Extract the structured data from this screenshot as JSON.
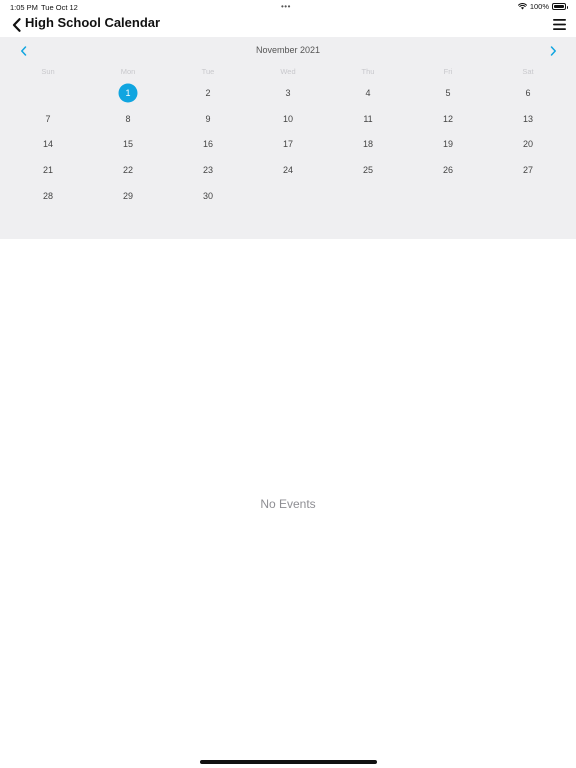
{
  "status_bar": {
    "time": "1:05 PM",
    "date": "Tue Oct 12",
    "dots": "•••",
    "battery": "100%"
  },
  "nav": {
    "title": "High School Calendar",
    "back_icon": "chevron-left-icon",
    "menu_icon": "hamburger-menu-icon"
  },
  "calendar": {
    "month_label": "November 2021",
    "accent_color": "#10a5e0",
    "weekdays": [
      "Sun",
      "Mon",
      "Tue",
      "Wed",
      "Thu",
      "Fri",
      "Sat"
    ],
    "selected_day": "1",
    "days": [
      "",
      "1",
      "2",
      "3",
      "4",
      "5",
      "6",
      "7",
      "8",
      "9",
      "10",
      "11",
      "12",
      "13",
      "14",
      "15",
      "16",
      "17",
      "18",
      "19",
      "20",
      "21",
      "22",
      "23",
      "24",
      "25",
      "26",
      "27",
      "28",
      "29",
      "30",
      "",
      "",
      "",
      ""
    ]
  },
  "events": {
    "empty_message": "No Events"
  }
}
